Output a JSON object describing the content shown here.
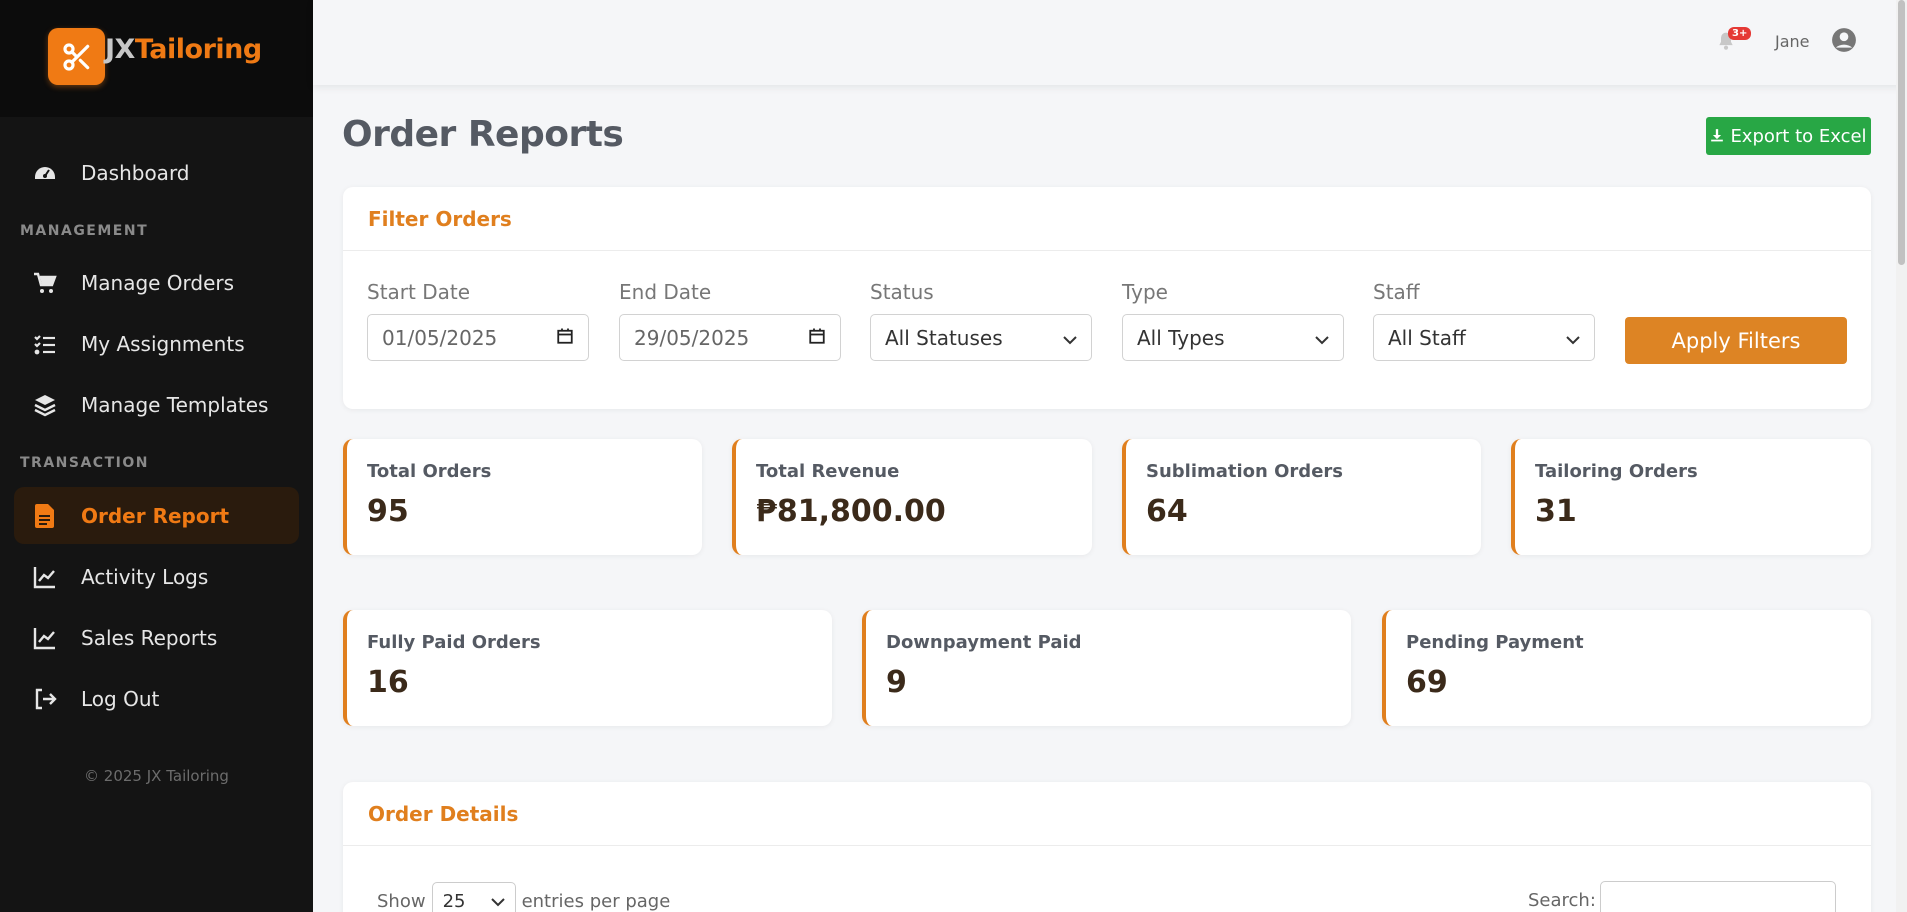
{
  "brand": {
    "jx": "JX",
    "name": "Tailoring"
  },
  "sidebar": {
    "items": [
      {
        "label": "Dashboard",
        "icon": "gauge-icon"
      },
      {
        "label": "Manage Orders",
        "icon": "cart-icon"
      },
      {
        "label": "My Assignments",
        "icon": "tasks-icon"
      },
      {
        "label": "Manage Templates",
        "icon": "layers-icon"
      },
      {
        "label": "Order Report",
        "icon": "file-icon",
        "active": true
      },
      {
        "label": "Activity Logs",
        "icon": "chart-line-icon"
      },
      {
        "label": "Sales Reports",
        "icon": "chart-line-icon"
      },
      {
        "label": "Log Out",
        "icon": "logout-icon"
      }
    ],
    "sections": {
      "management": "MANAGEMENT",
      "transaction": "TRANSACTION"
    },
    "copyright": "© 2025 JX Tailoring"
  },
  "topbar": {
    "notification_count": "3+",
    "username": "Jane"
  },
  "page": {
    "title": "Order Reports",
    "export_label": "Export to Excel"
  },
  "filters": {
    "title": "Filter Orders",
    "start_date": {
      "label": "Start Date",
      "value": "01/05/2025"
    },
    "end_date": {
      "label": "End Date",
      "value": "29/05/2025"
    },
    "status": {
      "label": "Status",
      "value": "All Statuses"
    },
    "type": {
      "label": "Type",
      "value": "All Types"
    },
    "staff": {
      "label": "Staff",
      "value": "All Staff"
    },
    "apply_label": "Apply Filters"
  },
  "stats_row1": [
    {
      "label": "Total Orders",
      "value": "95"
    },
    {
      "label": "Total Revenue",
      "value": "₱81,800.00"
    },
    {
      "label": "Sublimation Orders",
      "value": "64"
    },
    {
      "label": "Tailoring Orders",
      "value": "31"
    }
  ],
  "stats_row2": [
    {
      "label": "Fully Paid Orders",
      "value": "16"
    },
    {
      "label": "Downpayment Paid",
      "value": "9"
    },
    {
      "label": "Pending Payment",
      "value": "69"
    }
  ],
  "details": {
    "title": "Order Details",
    "show": "Show",
    "entries_value": "25",
    "entries_suffix": "entries per page",
    "search_label": "Search:"
  },
  "colors": {
    "accent": "#e07f1e",
    "sidebar": "#141414",
    "export": "#28a745"
  }
}
